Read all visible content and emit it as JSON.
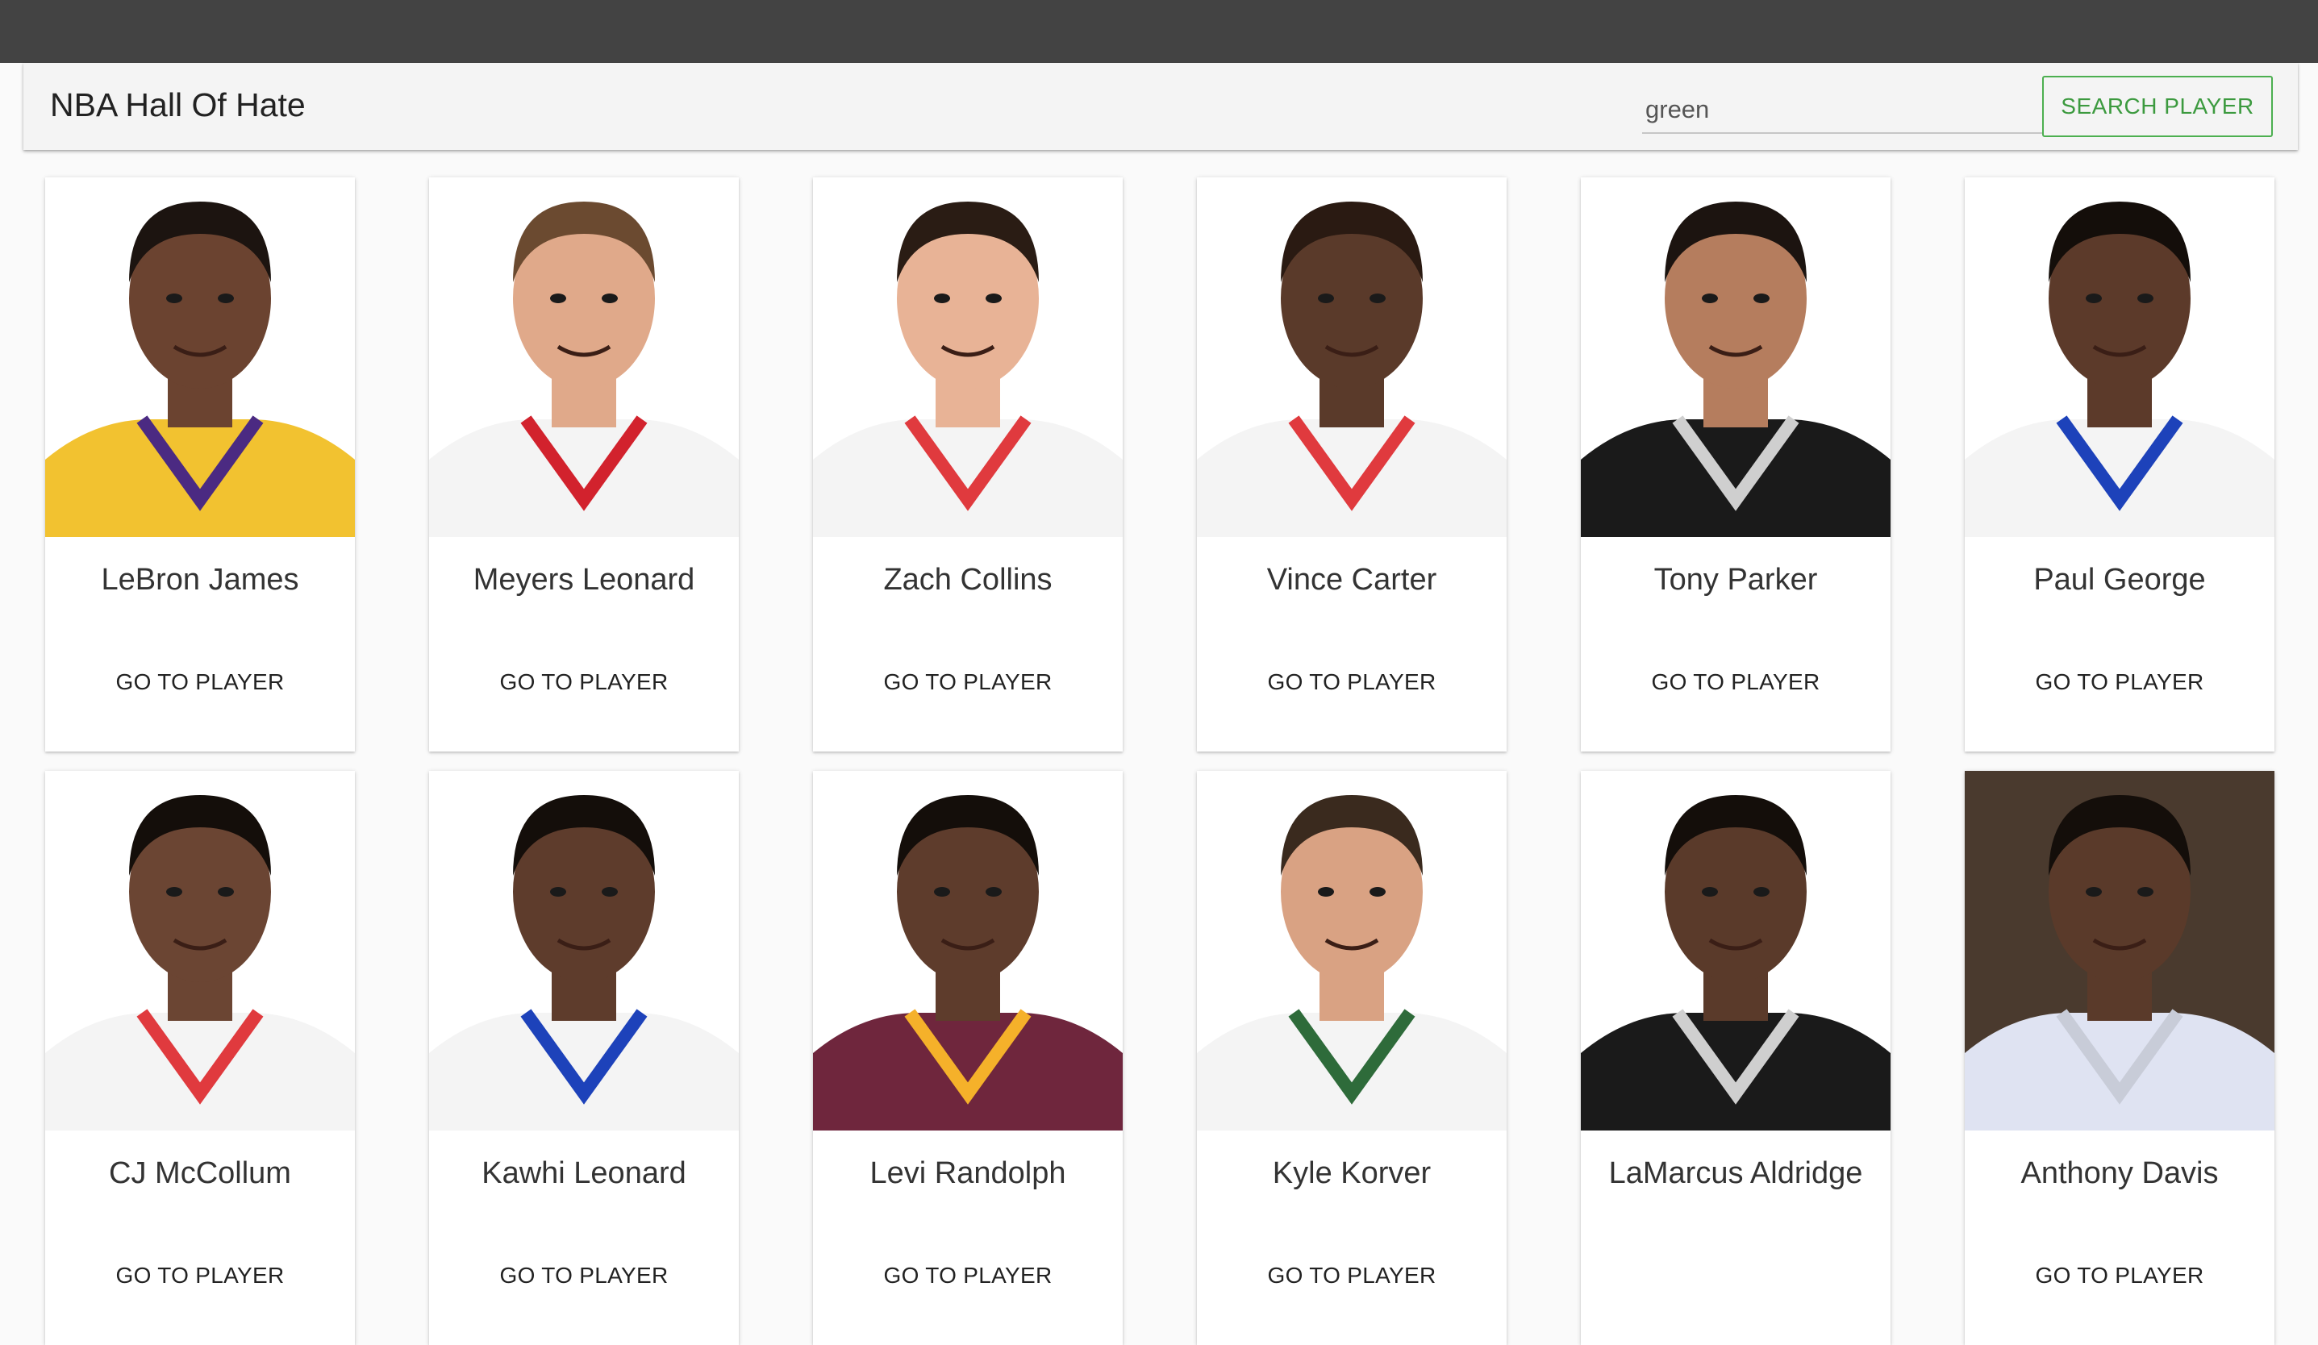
{
  "app": {
    "title": "NBA Hall Of Hate"
  },
  "search": {
    "value": "green",
    "button_label": "SEARCH PLAYER"
  },
  "players": [
    {
      "name": "LeBron James",
      "action": "GO TO PLAYER",
      "skin": "#6b4330",
      "hair": "#1c1410",
      "jersey": "#f2c230",
      "trim": "#4b2a82",
      "bg": "#ffffff"
    },
    {
      "name": "Meyers Leonard",
      "action": "GO TO PLAYER",
      "skin": "#e0a98a",
      "hair": "#6b4a30",
      "jersey": "#f4f4f4",
      "trim": "#d2222d",
      "bg": "#ffffff"
    },
    {
      "name": "Zach Collins",
      "action": "GO TO PLAYER",
      "skin": "#e8b396",
      "hair": "#2a1c14",
      "jersey": "#f4f4f4",
      "trim": "#e03a3e",
      "bg": "#ffffff"
    },
    {
      "name": "Vince Carter",
      "action": "GO TO PLAYER",
      "skin": "#5a3a2a",
      "hair": "#2a1a12",
      "jersey": "#f4f4f4",
      "trim": "#e03a3e",
      "bg": "#ffffff"
    },
    {
      "name": "Tony Parker",
      "action": "GO TO PLAYER",
      "skin": "#b57d5e",
      "hair": "#1c1410",
      "jersey": "#1a1a1a",
      "trim": "#cfcfcf",
      "bg": "#ffffff"
    },
    {
      "name": "Paul George",
      "action": "GO TO PLAYER",
      "skin": "#5c3a2a",
      "hair": "#140e0a",
      "jersey": "#f4f4f4",
      "trim": "#1d42ba",
      "bg": "#ffffff"
    },
    {
      "name": "CJ McCollum",
      "action": "GO TO PLAYER",
      "skin": "#6b4533",
      "hair": "#140e0a",
      "jersey": "#f4f4f4",
      "trim": "#e03a3e",
      "bg": "#ffffff"
    },
    {
      "name": "Kawhi Leonard",
      "action": "GO TO PLAYER",
      "skin": "#5e3c2c",
      "hair": "#140e0a",
      "jersey": "#f4f4f4",
      "trim": "#1d42ba",
      "bg": "#ffffff"
    },
    {
      "name": "Levi Randolph",
      "action": "GO TO PLAYER",
      "skin": "#5e3c2c",
      "hair": "#140e0a",
      "jersey": "#6f263d",
      "trim": "#f5b12a",
      "bg": "#ffffff"
    },
    {
      "name": "Kyle Korver",
      "action": "GO TO PLAYER",
      "skin": "#d9a283",
      "hair": "#3a2a1e",
      "jersey": "#f4f4f4",
      "trim": "#2e6b3a",
      "bg": "#ffffff"
    },
    {
      "name": "LaMarcus Aldridge",
      "action": "",
      "skin": "#5a3a2a",
      "hair": "#140e0a",
      "jersey": "#1a1a1a",
      "trim": "#cfcfcf",
      "bg": "#ffffff"
    },
    {
      "name": "Anthony Davis",
      "action": "GO TO PLAYER",
      "skin": "#5a3a2a",
      "hair": "#140e0a",
      "jersey": "#dfe3f2",
      "trim": "#c8ccd8",
      "bg": "#4a3a2e"
    }
  ]
}
